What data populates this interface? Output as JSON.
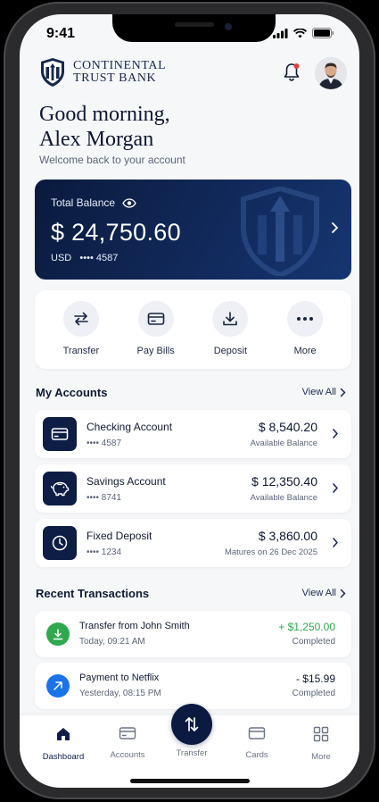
{
  "status_bar": {
    "time": "9:41"
  },
  "brand": {
    "line1": "CONTINENTAL",
    "line2": "TRUST BANK"
  },
  "greeting": {
    "line1": "Good morning,",
    "line2": "Alex Morgan",
    "subtitle": "Welcome back to your account"
  },
  "balance_card": {
    "label": "Total Balance",
    "amount": "$ 24,750.60",
    "currency": "USD",
    "account_masked": "•••• 4587"
  },
  "quick_actions": [
    {
      "label": "Transfer",
      "icon": "transfer-icon"
    },
    {
      "label": "Pay Bills",
      "icon": "bill-card-icon"
    },
    {
      "label": "Deposit",
      "icon": "deposit-icon"
    },
    {
      "label": "More",
      "icon": "more-dots-icon"
    }
  ],
  "accounts_section": {
    "title": "My Accounts",
    "view_all": "View All"
  },
  "accounts": [
    {
      "name": "Checking Account",
      "number": "•••• 4587",
      "amount": "$ 8,540.20",
      "sub": "Available Balance",
      "icon": "card-icon"
    },
    {
      "name": "Savings Account",
      "number": "•••• 8741",
      "amount": "$ 12,350.40",
      "sub": "Available Balance",
      "icon": "piggy-bank-icon"
    },
    {
      "name": "Fixed Deposit",
      "number": "•••• 1234",
      "amount": "$ 3,860.00",
      "sub": "Matures on 26 Dec 2025",
      "icon": "clock-icon"
    }
  ],
  "transactions_section": {
    "title": "Recent Transactions",
    "view_all": "View All"
  },
  "transactions": [
    {
      "name": "Transfer from John Smith",
      "time": "Today, 09:21 AM",
      "amount": "+ $1,250.00",
      "status": "Completed",
      "color": "#2fa84f"
    },
    {
      "name": "Payment to Netflix",
      "time": "Yesterday, 08:15 PM",
      "amount": "- $15.99",
      "status": "Completed",
      "color": "#1a73e8"
    }
  ],
  "bottom_nav": {
    "dashboard": "Dashboard",
    "accounts": "Accounts",
    "transfer": "Transfer",
    "cards": "Cards",
    "more": "More"
  },
  "colors": {
    "navy": "#0b1a41",
    "positive": "#2fa84f",
    "accent_blue": "#1a73e8"
  }
}
